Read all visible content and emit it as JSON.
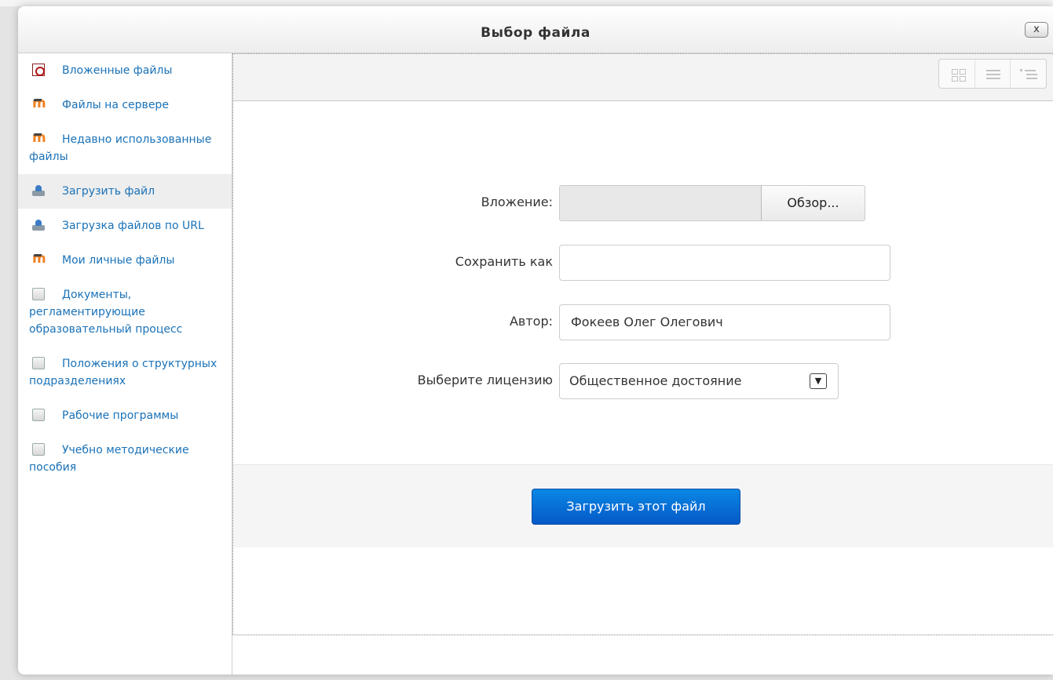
{
  "dialog": {
    "title": "Выбор файла",
    "close_label": "x"
  },
  "sidebar": {
    "items": [
      {
        "label": "Вложенные файлы",
        "icon": "pdf-icon"
      },
      {
        "label": "Файлы на сервере",
        "icon": "moodle-icon"
      },
      {
        "label": "Недавно использованные файлы",
        "icon": "moodle-icon"
      },
      {
        "label": "Загрузить файл",
        "icon": "upload-icon",
        "active": true
      },
      {
        "label": "Загрузка файлов по URL",
        "icon": "upload-icon"
      },
      {
        "label": "Мои личные файлы",
        "icon": "moodle-icon"
      },
      {
        "label": "Документы, регламентирующие образовательный процесс",
        "icon": "repository-icon"
      },
      {
        "label": "Положения о структурных подразделениях",
        "icon": "repository-icon"
      },
      {
        "label": "Рабочие программы",
        "icon": "repository-icon"
      },
      {
        "label": "Учебно методические пособия",
        "icon": "repository-icon"
      }
    ]
  },
  "toolbar": {
    "views": [
      "icons-view",
      "list-view",
      "tree-view"
    ]
  },
  "form": {
    "attachment_label": "Вложение:",
    "browse_label": "Обзор...",
    "saveas_label": "Сохранить как",
    "saveas_value": "",
    "author_label": "Автор:",
    "author_value": "Фокеев Олег Олегович",
    "license_label": "Выберите лицензию",
    "license_value": "Общественное достояние",
    "submit_label": "Загрузить этот файл"
  },
  "colors": {
    "link": "#1a72b8",
    "primary_button": "#0a6fd6"
  }
}
